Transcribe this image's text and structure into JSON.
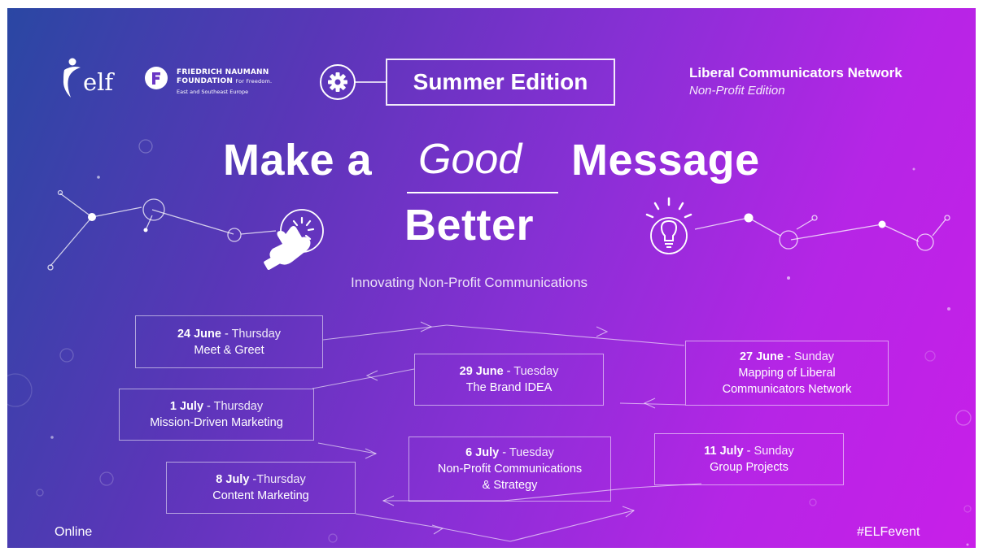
{
  "header": {
    "elf_logo_text": "elf",
    "fnf": {
      "line1": "FRIEDRICH NAUMANN",
      "line2": "FOUNDATION",
      "line2_small": "For Freedom.",
      "line3": "East and Southeast Europe"
    },
    "edition": "Summer Edition",
    "network_title": "Liberal Communicators Network",
    "network_subtitle": "Non-Profit Edition"
  },
  "headline": {
    "part1": "Make a",
    "good": "Good",
    "part2": "Message",
    "line2": "Better"
  },
  "tagline": "Innovating Non-Profit Communications",
  "schedule": [
    {
      "date": "24 June",
      "sep": " - ",
      "weekday": "Thursday",
      "title": "Meet & Greet"
    },
    {
      "date": "27 June",
      "sep": " - ",
      "weekday": "Sunday",
      "title": "Mapping of Liberal",
      "title2": "Communicators Network"
    },
    {
      "date": "29 June",
      "sep": " - ",
      "weekday": "Tuesday",
      "title": "The Brand IDEA"
    },
    {
      "date": "1 July",
      "sep": " - ",
      "weekday": "Thursday",
      "title": "Mission-Driven Marketing"
    },
    {
      "date": "6 July",
      "sep": " - ",
      "weekday": "Tuesday",
      "title": "Non-Profit Communications",
      "title2": "& Strategy"
    },
    {
      "date": "11 July",
      "sep": " - ",
      "weekday": "Sunday",
      "title": "Group Projects"
    },
    {
      "date": "8 July",
      "sep": " -",
      "weekday": "Thursday",
      "title": "Content Marketing"
    }
  ],
  "footer": {
    "left": "Online",
    "right": "#ELFevent"
  },
  "icons": [
    "elf-logo-icon",
    "fnf-logo-icon",
    "gear-icon",
    "pointer-hand-icon",
    "lightbulb-icon"
  ]
}
